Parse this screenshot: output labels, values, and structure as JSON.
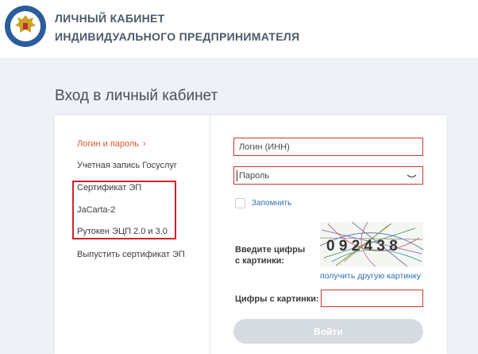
{
  "header": {
    "title_line1": "ЛИЧНЫЙ КАБИНЕТ",
    "title_line2": "ИНДИВИДУАЛЬНОГО ПРЕДПРИНИМАТЕЛЯ"
  },
  "page": {
    "title": "Вход в личный кабинет"
  },
  "menu": {
    "items": [
      {
        "label": "Логин и пароль",
        "active": true
      },
      {
        "label": "Учетная запись Госуслуг"
      },
      {
        "label": "Сертификат ЭП"
      },
      {
        "label": "JaCarta-2"
      },
      {
        "label": "Рутокен ЭЦП 2.0 и 3.0"
      },
      {
        "label": "Выпустить сертификат ЭП"
      }
    ],
    "active_chevron": "›"
  },
  "form": {
    "login_placeholder": "Логин (ИНН)",
    "password_placeholder": "Пароль",
    "remember_label": "Запомнить",
    "captcha_label_line1": "Введите цифры",
    "captcha_label_line2": "с картинки:",
    "captcha_text": "0 9 2 4 3 8",
    "captcha_refresh": "получить другую картинку",
    "code_label": "Цифры с картинки:",
    "submit_label": "Войти"
  },
  "colors": {
    "accent": "#e1562c",
    "link": "#2b6fb6",
    "field_border": "#c5392b",
    "highlight_box": "#d2212b",
    "button_disabled": "#d6dbe2"
  },
  "icons": [
    "emblem-logo",
    "chevron-right-icon",
    "eye-icon",
    "captcha-image"
  ]
}
